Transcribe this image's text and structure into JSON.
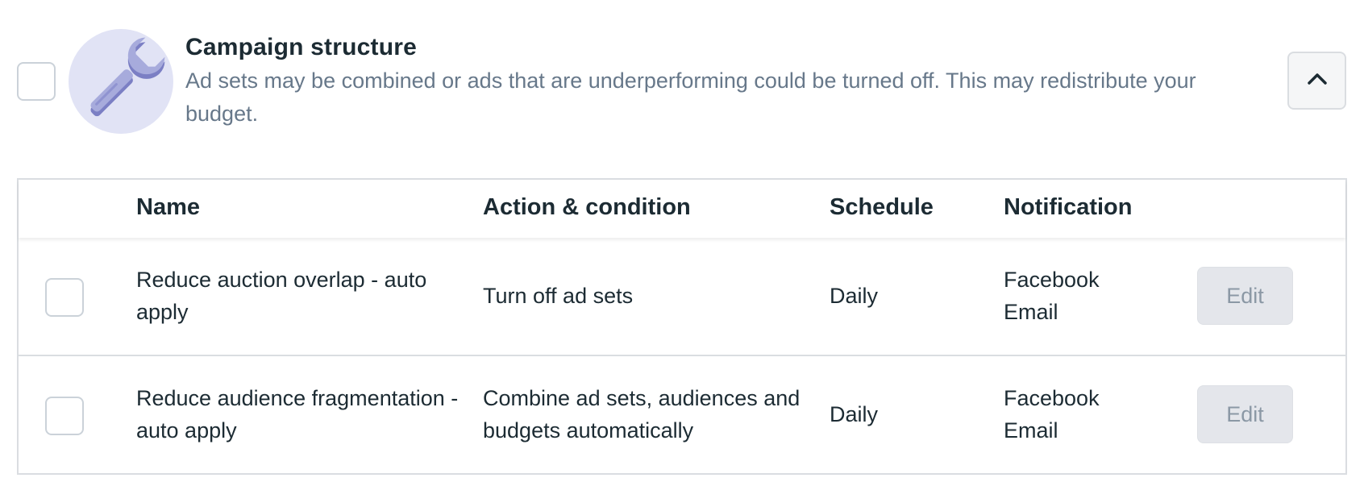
{
  "section": {
    "title": "Campaign structure",
    "description": "Ad sets may be combined or ads that are underperforming could be turned off. This may redistribute your budget.",
    "icon": "wrench-icon",
    "collapse_icon": "chevron-up-icon"
  },
  "colors": {
    "badge_bg": "#e1e3f5",
    "wrench_fill": "#a7abdc",
    "wrench_shade": "#7b7fc4",
    "text_primary": "#1c2b33",
    "text_secondary": "#67788a",
    "border": "#dadde1",
    "edit_bg": "#e4e6eb",
    "edit_text": "#8b98a5"
  },
  "table": {
    "columns": [
      "",
      "Name",
      "Action & condition",
      "Schedule",
      "Notification",
      ""
    ],
    "rows": [
      {
        "name": "Reduce auction overlap - auto apply",
        "action": "Turn off ad sets",
        "schedule": "Daily",
        "notification_line1": "Facebook",
        "notification_line2": "Email",
        "edit_label": "Edit"
      },
      {
        "name": "Reduce audience fragmentation - auto apply",
        "action": "Combine ad sets, audiences and budgets automatically",
        "schedule": "Daily",
        "notification_line1": "Facebook",
        "notification_line2": "Email",
        "edit_label": "Edit"
      }
    ]
  }
}
